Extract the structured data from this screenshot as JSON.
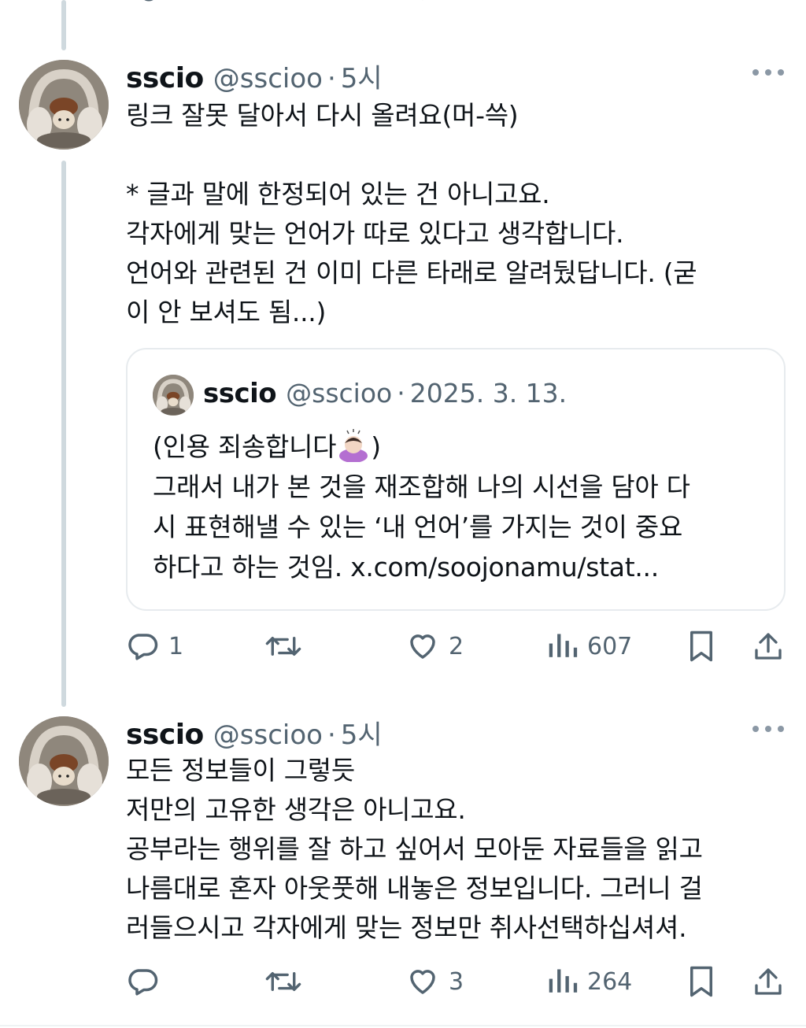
{
  "tweets": [
    {
      "display_name": "sscio",
      "handle": "@sscioo",
      "time": "5시",
      "body": "링크 잘못 달아서 다시 올려요(머-쓱)\n\n* 글과 말에 한정되어 있는 건 아니고요.\n각자에게 맞는 언어가 따로 있다고 생각합니다.\n언어와 관련된 건 이미 다른 타래로 알려뒀답니다. (굳\n이 안 보셔도 됨...)",
      "quote": {
        "display_name": "sscio",
        "handle": "@sscioo",
        "date": "2025. 3. 13.",
        "body_prefix": "(인용 죄송합니다",
        "body_suffix": ")",
        "body_rest": "그래서 내가 본 것을 재조합해 나의 시선을 담아 다\n시 표현해낼 수 있는 ‘내 언어’를 가지는 것이 중요\n하다고 하는 것임. x.com/soojonamu/stat...",
        "emoji": "person-bowing-emoji"
      },
      "stats": {
        "replies": "1",
        "retweets": "",
        "likes": "2",
        "views": "607"
      }
    },
    {
      "display_name": "sscio",
      "handle": "@sscioo",
      "time": "5시",
      "body": "모든 정보들이 그렇듯\n저만의 고유한 생각은 아니고요.\n공부라는 행위를 잘 하고 싶어서 모아둔 자료들을 읽고\n나름대로 혼자 아웃풋해 내놓은 정보입니다. 그러니 걸\n러들으시고 각자에게 맞는 정보만 취사선택하십셔셔.",
      "stats": {
        "replies": "",
        "retweets": "",
        "likes": "3",
        "views": "264"
      }
    }
  ],
  "icons": {
    "reply": "reply-icon",
    "retweet": "retweet-icon",
    "like": "heart-icon",
    "views": "views-icon",
    "bookmark": "bookmark-icon",
    "share": "share-icon",
    "more": "more-icon"
  },
  "colors": {
    "text": "#0f1419",
    "secondary": "#536471",
    "thread_line": "#cfd9de",
    "border": "#e7ebee"
  }
}
